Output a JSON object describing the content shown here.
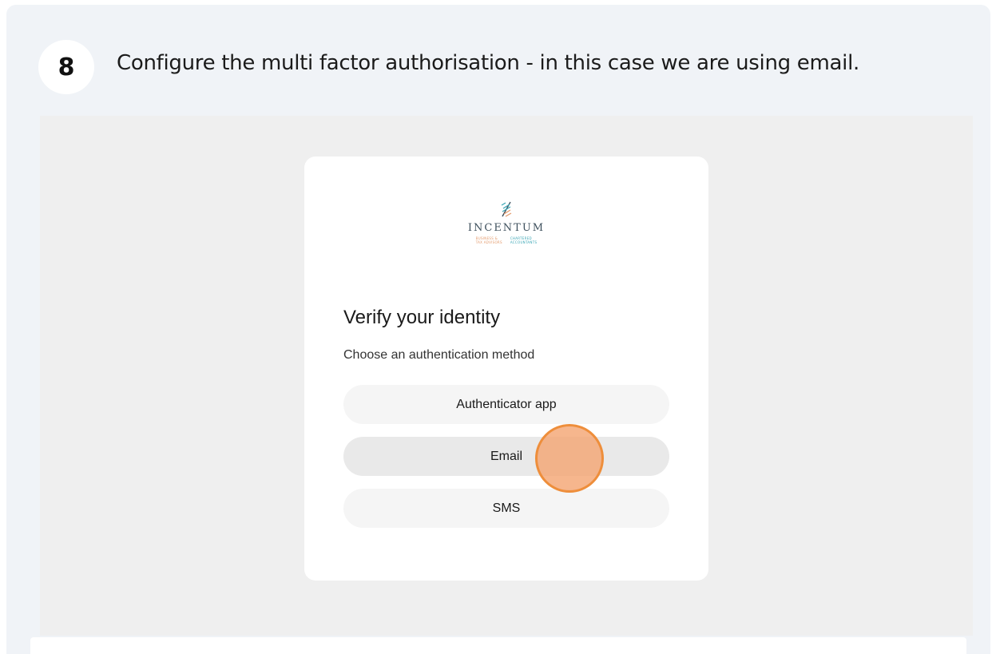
{
  "step": {
    "number": "8",
    "instruction": "Configure the multi factor authorisation - in this case we are using email."
  },
  "logo": {
    "wordmark": "INCENTUM",
    "tag_left": [
      "BUSINESS &",
      "TAX ADVISORS"
    ],
    "tag_right": [
      "CHARTERED",
      "ACCOUNTANTS"
    ],
    "colors": {
      "left": "#e39a6b",
      "right": "#3aa6b5",
      "wordmark": "#3d4f5c"
    }
  },
  "auth": {
    "title": "Verify your identity",
    "subtitle": "Choose an authentication method",
    "methods": [
      {
        "label": "Authenticator app"
      },
      {
        "label": "Email"
      },
      {
        "label": "SMS"
      }
    ],
    "highlighted_method": "Email"
  },
  "colors": {
    "accent": "#ee8e3b",
    "card_bg": "#f0f3f7",
    "screenshot_bg": "#efefef"
  }
}
